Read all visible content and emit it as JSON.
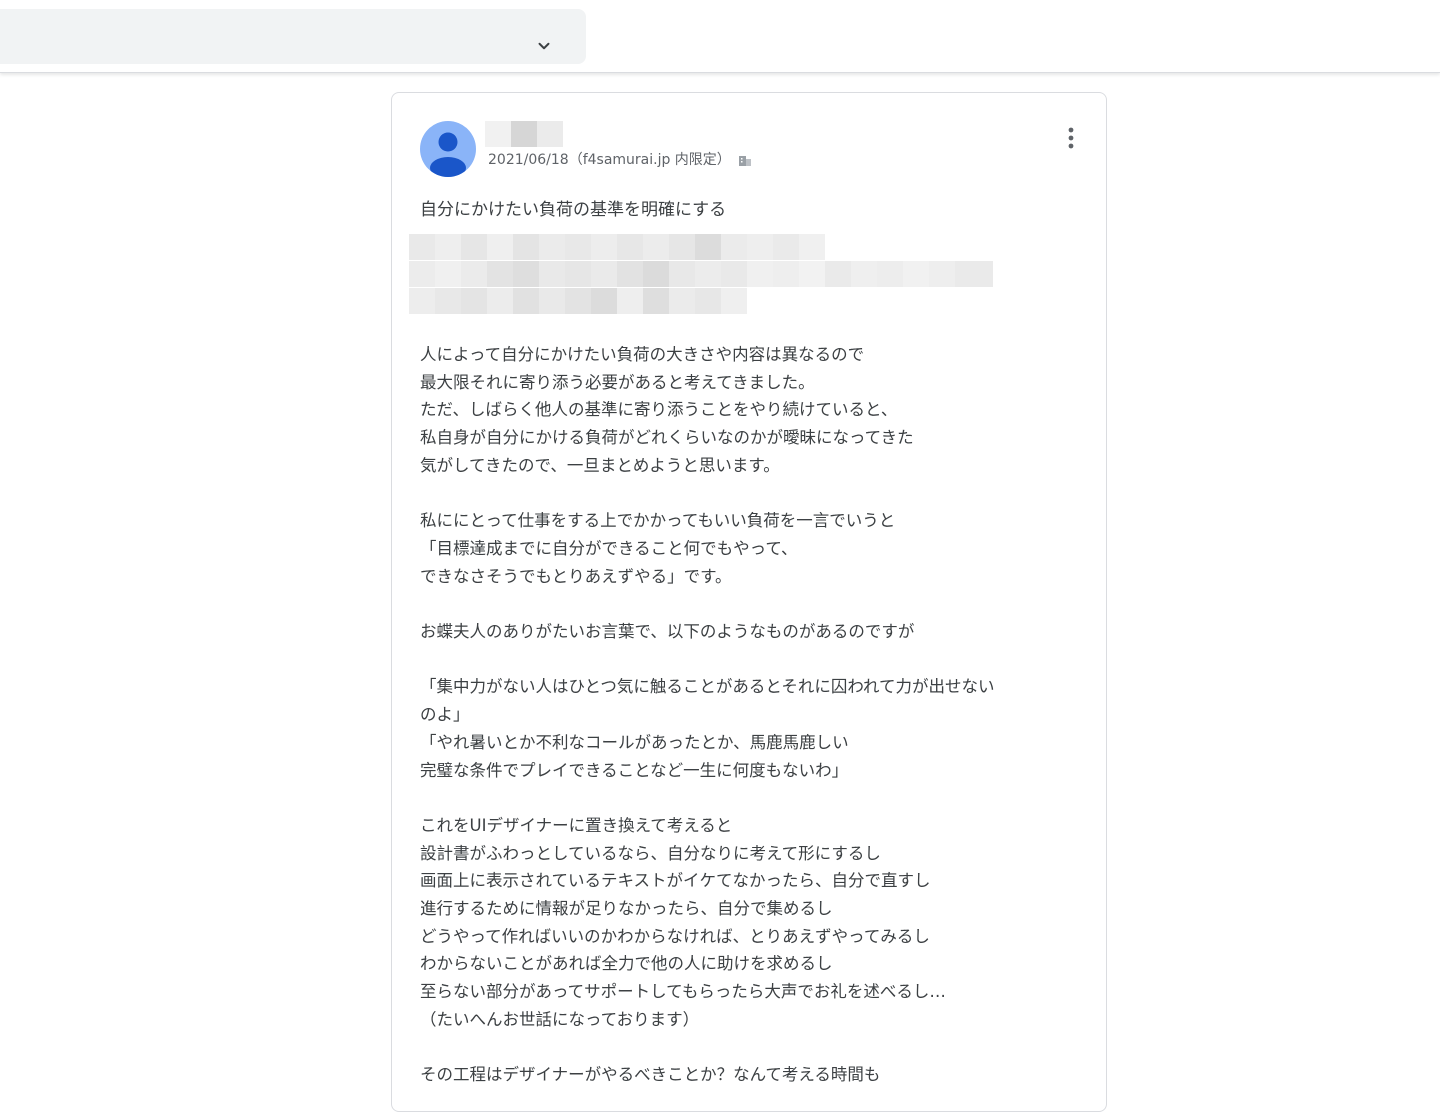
{
  "header": {
    "select_value": "",
    "chevron_icon": "chevron-down-icon"
  },
  "post": {
    "avatar_icon": "person-avatar-icon",
    "author_name": "",
    "meta": "2021/06/18（f4samurai.jp 内限定）",
    "visibility_icon": "building-icon",
    "menu_icon": "more-vert-icon",
    "title": "自分にかけたい負荷の基準を明確にする",
    "body_lines": [
      "人によって自分にかけたい負荷の大きさや内容は異なるので",
      "最大限それに寄り添う必要があると考えてきました。",
      "ただ、しばらく他人の基準に寄り添うことをやり続けていると、",
      "私自身が自分にかける負荷がどれくらいなのかが曖昧になってきた",
      "気がしてきたので、一旦まとめようと思います。",
      "",
      "私ににとって仕事をする上でかかってもいい負荷を一言でいうと",
      "「目標達成までに自分ができること何でもやって、",
      "できなさそうでもとりあえずやる」です。",
      "",
      "お蝶夫人のありがたいお言葉で、以下のようなものがあるのですが",
      "",
      "「集中力がない人はひとつ気に触ることがあるとそれに囚われて力が出せない",
      "のよ」",
      "「やれ暑いとか不利なコールがあったとか、馬鹿馬鹿しい",
      "完璧な条件でプレイできることなど一生に何度もないわ」",
      "",
      "これをUIデザイナーに置き換えて考えると",
      "設計書がふわっとしているなら、自分なりに考えて形にするし",
      "画面上に表示されているテキストがイケてなかったら、自分で直すし",
      "進行するために情報が足りなかったら、自分で集めるし",
      "どうやって作ればいいのかわからなければ、とりあえずやってみるし",
      "わからないことがあれば全力で他の人に助けを求めるし",
      "至らない部分があってサポートしてもらったら大声でお礼を述べるし…",
      "（たいへんお世話になっております）",
      "",
      "その工程はデザイナーがやるべきことか？なんて考える時間も"
    ]
  }
}
